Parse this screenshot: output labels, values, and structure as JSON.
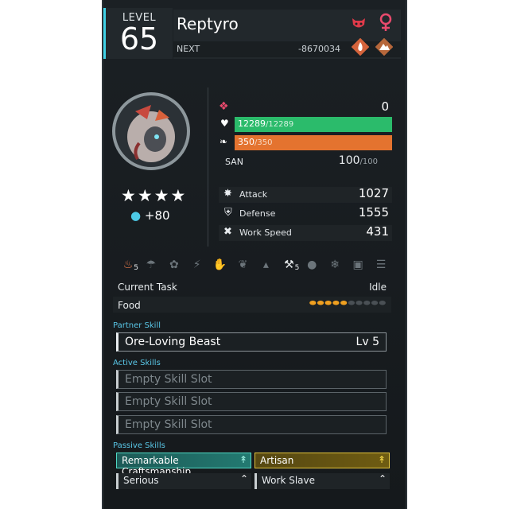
{
  "header": {
    "level_label": "LEVEL",
    "level": "65",
    "name": "Reptyro",
    "next_label": "NEXT",
    "next_value": "-8670034",
    "icons": [
      "enemy-face-icon",
      "female-icon",
      "fire-element-icon",
      "ground-element-icon"
    ],
    "colors": {
      "accent": "#3fd1e6",
      "enemy": "#e03a4a",
      "element_badge": "#d5643c"
    }
  },
  "portrait": {
    "icon": "reptyro-portrait",
    "stars": "★★★★",
    "condenser": "+80"
  },
  "stats": {
    "trust": "0",
    "hp": {
      "current": "12289",
      "max": "/12289",
      "fraction": 1.0,
      "color": "#2bbb6b"
    },
    "sp": {
      "current": "350",
      "max": "/350",
      "fraction": 1.0,
      "color": "#e4732f"
    },
    "san": {
      "label": "SAN",
      "value": "100",
      "max": "/100"
    },
    "attack": {
      "label": "Attack",
      "value": "1027"
    },
    "defense": {
      "label": "Defense",
      "value": "1555"
    },
    "work_speed": {
      "label": "Work Speed",
      "value": "431"
    }
  },
  "work": {
    "kindling": "5",
    "mining": "5",
    "current_task_label": "Current Task",
    "current_task_value": "Idle",
    "food_label": "Food",
    "food_full": 5,
    "food_total": 10
  },
  "partner": {
    "title": "Partner Skill",
    "name": "Ore-Loving Beast",
    "lv_label": "Lv",
    "lv": "5"
  },
  "active": {
    "title": "Active Skills",
    "slots": [
      "Empty Skill Slot",
      "Empty Skill Slot",
      "Empty Skill Slot"
    ]
  },
  "passive": {
    "title": "Passive Skills",
    "skills": [
      "Remarkable Craftsmanship",
      "Artisan",
      "Serious",
      "Work Slave"
    ]
  }
}
